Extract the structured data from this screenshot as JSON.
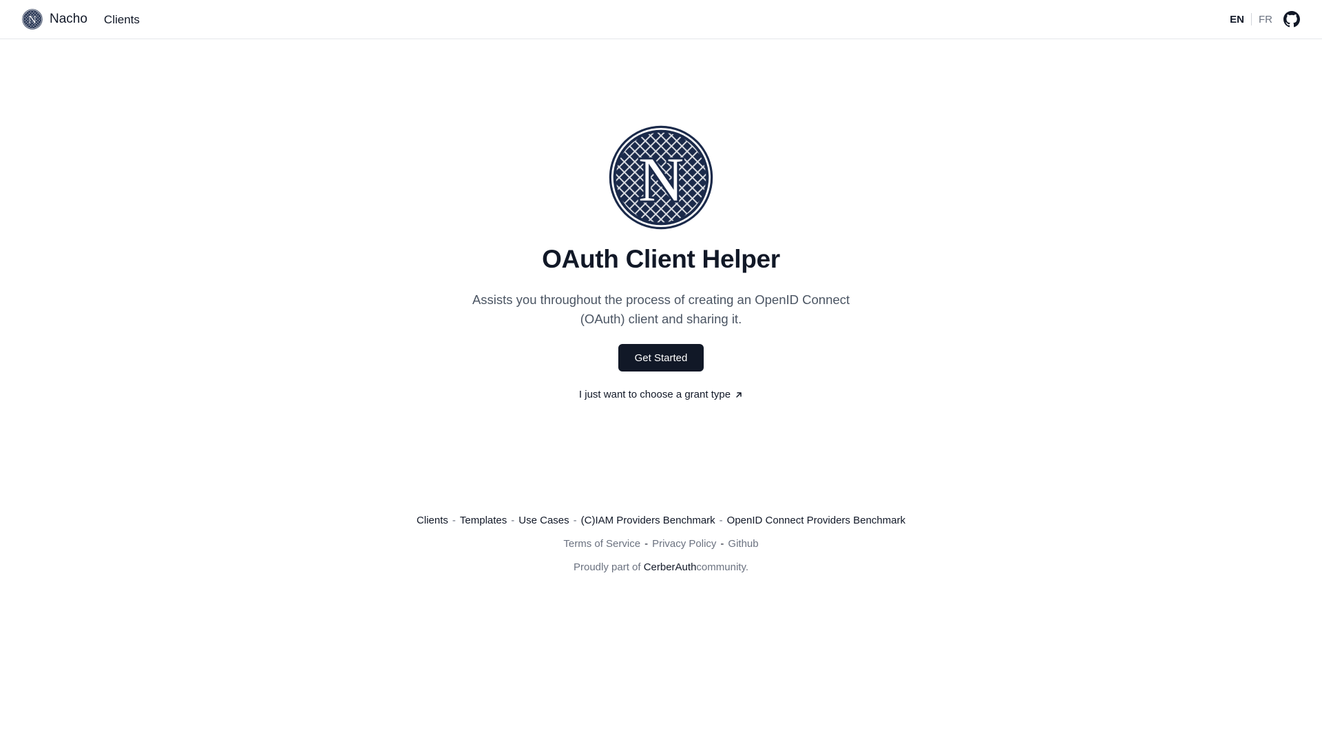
{
  "colors": {
    "brand_navy": "#1b2a4a",
    "primary_text": "#111827",
    "muted_text": "#6b7280",
    "button_bg": "#111827"
  },
  "header": {
    "brand_name": "Nacho",
    "logo_letter": "N",
    "nav": {
      "clients": "Clients"
    },
    "languages": {
      "en": "EN",
      "fr": "FR",
      "active": "EN"
    },
    "github_icon": "github-icon"
  },
  "hero": {
    "logo_letter": "N",
    "title": "OAuth Client Helper",
    "description": "Assists you throughout the process of creating an OpenID Connect (OAuth) client and sharing it.",
    "cta_label": "Get Started",
    "grant_link_label": "I just want to choose a grant type",
    "grant_link_icon": "arrow-up-right-icon"
  },
  "footer": {
    "links": [
      "Clients",
      "Templates",
      "Use Cases",
      "(C)IAM Providers Benchmark",
      "OpenID Connect Providers Benchmark"
    ],
    "link_separator": "-",
    "legal": [
      "Terms of Service",
      "Privacy Policy",
      "Github"
    ],
    "community_prefix": "Proudly part of ",
    "community_name": "CerberAuth",
    "community_suffix": "community."
  }
}
